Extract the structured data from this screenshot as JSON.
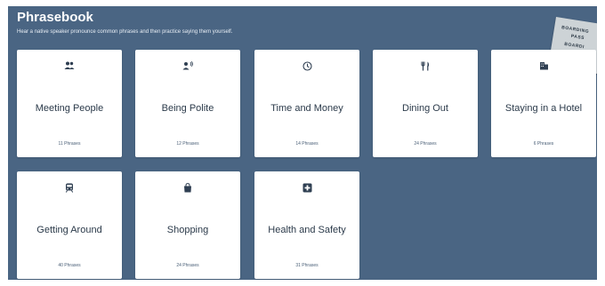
{
  "header": {
    "title": "Phrasebook",
    "subtitle": "Hear a native speaker pronounce common phrases and then practice saying them yourself."
  },
  "decoration": {
    "pass_line1": "BOARDING",
    "pass_line2": "PASS",
    "pass_line3": "BOARDI"
  },
  "categories": [
    {
      "label": "Meeting People",
      "count": "11 Phrases",
      "icon": "people-icon"
    },
    {
      "label": "Being Polite",
      "count": "12 Phrases",
      "icon": "person-speaking-icon"
    },
    {
      "label": "Time and Money",
      "count": "14 Phrases",
      "icon": "clock-icon"
    },
    {
      "label": "Dining Out",
      "count": "24 Phrases",
      "icon": "fork-knife-icon"
    },
    {
      "label": "Staying in a Hotel",
      "count": "6 Phrases",
      "icon": "hotel-icon"
    },
    {
      "label": "Getting Around",
      "count": "40 Phrases",
      "icon": "train-icon"
    },
    {
      "label": "Shopping",
      "count": "24 Phrases",
      "icon": "shopping-bag-icon"
    },
    {
      "label": "Health and Safety",
      "count": "31 Phrases",
      "icon": "first-aid-icon"
    }
  ],
  "colors": {
    "background": "#4a6583",
    "card": "#ffffff",
    "icon": "#2f3f52",
    "text": "#2b3a4a"
  }
}
